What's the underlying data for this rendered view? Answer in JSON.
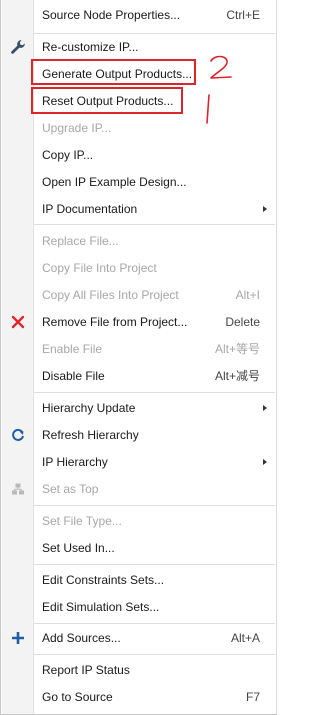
{
  "menu": {
    "source_node_properties": {
      "label": "Source Node Properties...",
      "shortcut": "Ctrl+E"
    },
    "recustomize_ip": {
      "label": "Re-customize IP..."
    },
    "generate_output_products": {
      "label": "Generate Output Products..."
    },
    "reset_output_products": {
      "label": "Reset Output Products..."
    },
    "upgrade_ip": {
      "label": "Upgrade IP..."
    },
    "copy_ip": {
      "label": "Copy IP..."
    },
    "open_ip_example_design": {
      "label": "Open IP Example Design..."
    },
    "ip_documentation": {
      "label": "IP Documentation"
    },
    "replace_file": {
      "label": "Replace File..."
    },
    "copy_file_into_project": {
      "label": "Copy File Into Project"
    },
    "copy_all_files_into_project": {
      "label": "Copy All Files Into Project",
      "shortcut": "Alt+I"
    },
    "remove_file_from_project": {
      "label": "Remove File from Project...",
      "shortcut": "Delete"
    },
    "enable_file": {
      "label": "Enable File",
      "shortcut": "Alt+等号"
    },
    "disable_file": {
      "label": "Disable File",
      "shortcut": "Alt+减号"
    },
    "hierarchy_update": {
      "label": "Hierarchy Update"
    },
    "refresh_hierarchy": {
      "label": "Refresh Hierarchy"
    },
    "ip_hierarchy": {
      "label": "IP Hierarchy"
    },
    "set_as_top": {
      "label": "Set as Top"
    },
    "set_file_type": {
      "label": "Set File Type..."
    },
    "set_used_in": {
      "label": "Set Used In..."
    },
    "edit_constraints_sets": {
      "label": "Edit Constraints Sets..."
    },
    "edit_simulation_sets": {
      "label": "Edit Simulation Sets..."
    },
    "add_sources": {
      "label": "Add Sources...",
      "shortcut": "Alt+A"
    },
    "report_ip_status": {
      "label": "Report IP Status"
    },
    "go_to_source": {
      "label": "Go to Source",
      "shortcut": "F7"
    }
  },
  "icons": {
    "wrench": "wrench-icon",
    "remove": "red-x-icon",
    "refresh": "refresh-icon",
    "set_top": "hierarchy-top-icon",
    "add": "plus-icon"
  },
  "colors": {
    "highlight_box": "#d8262c",
    "remove_icon": "#e0262b",
    "refresh_icon": "#1f5fa8",
    "add_icon": "#1f5fa8",
    "disabled_text": "#a7a7a7"
  },
  "annotations": {
    "generate_note": "2",
    "reset_note": "1"
  }
}
